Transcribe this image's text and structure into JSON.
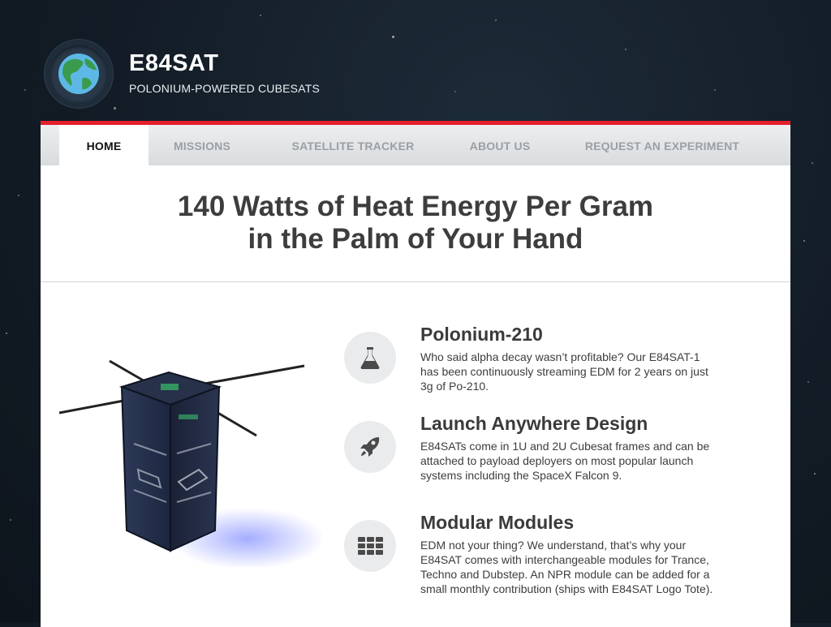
{
  "brand": {
    "title": "E84SAT",
    "tagline": "POLONIUM-POWERED CUBESATS",
    "logo_icon": "globe-icon"
  },
  "nav": {
    "items": [
      {
        "label": "HOME",
        "active": true
      },
      {
        "label": "MISSIONS",
        "active": false
      },
      {
        "label": "SATELLITE TRACKER",
        "active": false
      },
      {
        "label": "ABOUT US",
        "active": false
      },
      {
        "label": "REQUEST AN EXPERIMENT",
        "active": false
      }
    ]
  },
  "hero": {
    "line1": "140 Watts of Heat Energy Per Gram",
    "line2": "in the Palm of Your Hand"
  },
  "features": [
    {
      "icon": "flask-icon",
      "title": "Polonium-210",
      "body": "Who said alpha decay wasn’t profitable? Our E84SAT-1 has been continuously streaming EDM for 2 years on just 3g of Po-210."
    },
    {
      "icon": "rocket-icon",
      "title": "Launch Anywhere Design",
      "body": "E84SATs come in 1U and 2U Cubesat frames and can be attached to payload deployers on most popular launch systems including the SpaceX Falcon 9."
    },
    {
      "icon": "grid-icon",
      "title": "Modular Modules",
      "body": "EDM not your thing? We understand, that’s why your E84SAT comes with interchangeable modules for Trance, Techno and Dubstep. An NPR module can be added for a small monthly contribution (ships with E84SAT Logo Tote)."
    }
  ],
  "colors": {
    "accent": "#e41f2d",
    "background": "#131c26",
    "text": "#3d3d3d",
    "nav_inactive": "#9aa0a6"
  }
}
